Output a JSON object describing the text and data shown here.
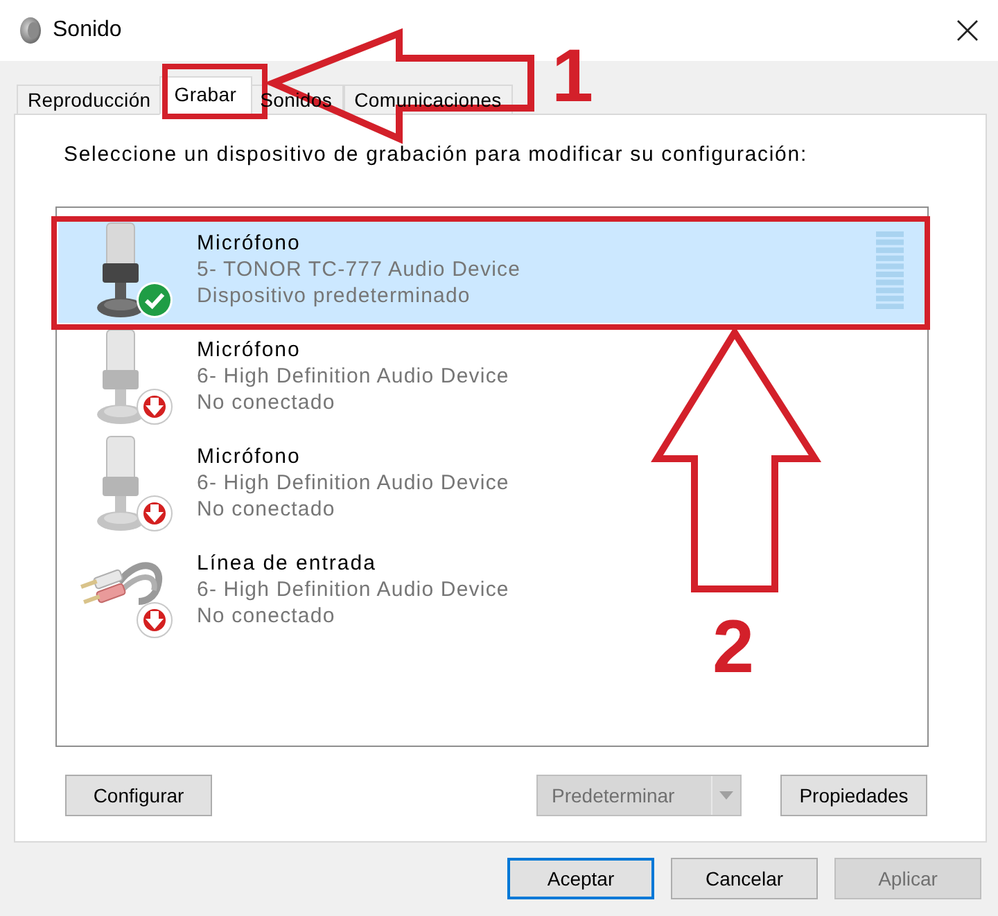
{
  "window": {
    "title": "Sonido"
  },
  "tabs": [
    {
      "label": "Reproducción",
      "selected": false
    },
    {
      "label": "Grabar",
      "selected": true
    },
    {
      "label": "Sonidos",
      "selected": false
    },
    {
      "label": "Comunicaciones",
      "selected": false
    }
  ],
  "instruction": "Seleccione un dispositivo de grabación para modificar su configuración:",
  "devices": [
    {
      "kind": "microphone",
      "name": "Micrófono",
      "description": "5- TONOR TC-777 Audio Device",
      "status_text": "Dispositivo predeterminado",
      "connected": true,
      "selected": true
    },
    {
      "kind": "microphone",
      "name": "Micrófono",
      "description": "6- High Definition Audio Device",
      "status_text": "No conectado",
      "connected": false,
      "selected": false
    },
    {
      "kind": "microphone",
      "name": "Micrófono",
      "description": "6- High Definition Audio Device",
      "status_text": "No conectado",
      "connected": false,
      "selected": false
    },
    {
      "kind": "line_in",
      "name": "Línea de entrada",
      "description": "6- High Definition Audio Device",
      "status_text": "No conectado",
      "connected": false,
      "selected": false
    }
  ],
  "device_buttons": [
    {
      "kind": "push",
      "label": "Configurar",
      "disabled": false
    },
    {
      "kind": "split",
      "label": "Predeterminar",
      "disabled": true
    },
    {
      "kind": "push",
      "label": "Propiedades",
      "disabled": false
    }
  ],
  "dialog_buttons": [
    {
      "label": "Aceptar",
      "default": true,
      "disabled": false
    },
    {
      "label": "Cancelar",
      "default": false,
      "disabled": false
    },
    {
      "label": "Aplicar",
      "default": false,
      "disabled": true
    }
  ],
  "annotations": [
    {
      "kind": "tab_marker",
      "label": "1"
    },
    {
      "kind": "row_marker",
      "label": "2"
    }
  ]
}
